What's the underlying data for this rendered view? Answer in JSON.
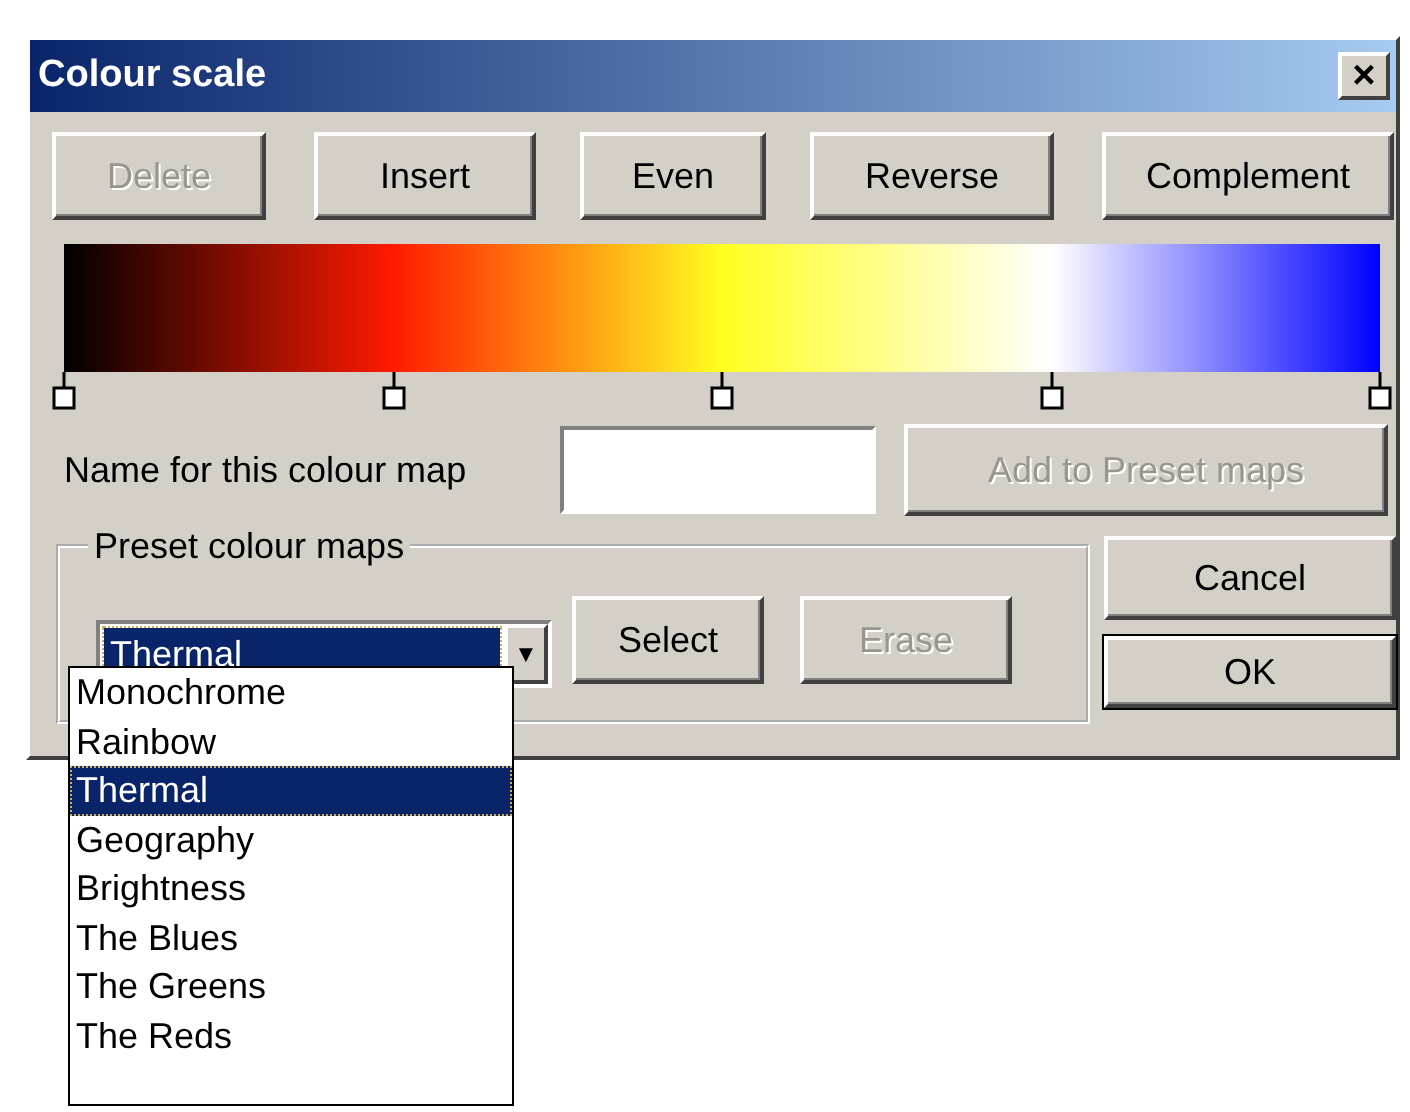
{
  "window": {
    "title": "Colour scale",
    "close": "×"
  },
  "toolbar": [
    {
      "label": "Delete",
      "disabled": true
    },
    {
      "label": "Insert",
      "disabled": false
    },
    {
      "label": "Even",
      "disabled": false
    },
    {
      "label": "Reverse",
      "disabled": false
    },
    {
      "label": "Complement",
      "disabled": false
    }
  ],
  "scale": {
    "stops": [
      {
        "color": "#000000"
      },
      {
        "color": "#ff1a00"
      },
      {
        "color": "#ffff20"
      },
      {
        "color": "#ffffff"
      },
      {
        "color": "#0000ff"
      }
    ]
  },
  "name_field": {
    "label": "Name for this colour map"
  },
  "add_button": {
    "label": "Add to Preset maps",
    "disabled": true
  },
  "preset_group": {
    "legend": "Preset colour maps",
    "combo_value": "Thermal",
    "combo_arrow": "▼",
    "buttons": [
      {
        "label": "Select",
        "disabled": false
      },
      {
        "label": "Erase",
        "disabled": true
      }
    ],
    "options": [
      {
        "label": "Monochrome",
        "selected": false
      },
      {
        "label": "Rainbow",
        "selected": false
      },
      {
        "label": "Thermal",
        "selected": true
      },
      {
        "label": "Geography",
        "selected": false
      },
      {
        "label": "Brightness",
        "selected": false
      },
      {
        "label": "The Blues",
        "selected": false
      },
      {
        "label": "The Greens",
        "selected": false
      },
      {
        "label": "The Reds",
        "selected": false
      }
    ]
  },
  "dialog_buttons": [
    {
      "label": "Cancel",
      "default": false
    },
    {
      "label": "OK",
      "default": true
    }
  ]
}
